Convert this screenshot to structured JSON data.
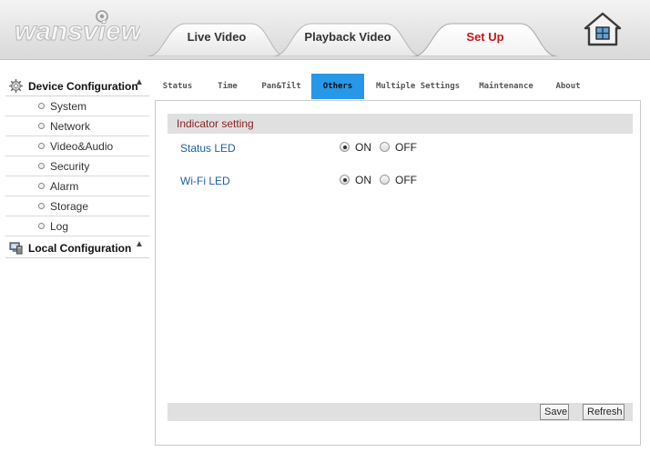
{
  "brand": {
    "logo_text": "wansview"
  },
  "nav": {
    "tabs": [
      {
        "label": "Live Video"
      },
      {
        "label": "Playback Video"
      },
      {
        "label": "Set Up",
        "active": true
      }
    ],
    "home_icon": "home-icon"
  },
  "sidebar": {
    "device_config": {
      "label": "Device Configuration",
      "icon": "gear-icon",
      "items": [
        {
          "label": "System"
        },
        {
          "label": "Network"
        },
        {
          "label": "Video&Audio"
        },
        {
          "label": "Security"
        },
        {
          "label": "Alarm"
        },
        {
          "label": "Storage"
        },
        {
          "label": "Log"
        }
      ]
    },
    "local_config": {
      "label": "Local Configuration",
      "icon": "computer-icon"
    }
  },
  "subtabs": [
    {
      "label": "Status"
    },
    {
      "label": "Time"
    },
    {
      "label": "Pan&Tilt"
    },
    {
      "label": "Others",
      "active": true
    },
    {
      "label": "Multiple Settings"
    },
    {
      "label": "Maintenance"
    },
    {
      "label": "About"
    }
  ],
  "panel": {
    "section_title": "Indicator setting",
    "settings": [
      {
        "label": "Status LED",
        "on_label": "ON",
        "off_label": "OFF",
        "value": "ON"
      },
      {
        "label": "Wi-Fi LED",
        "on_label": "ON",
        "off_label": "OFF",
        "value": "ON"
      }
    ],
    "buttons": {
      "save": "Save",
      "refresh": "Refresh"
    }
  },
  "colors": {
    "active_subtab": "#2897e6",
    "active_tab_text": "#c41818",
    "setting_label": "#1f5fa8",
    "section_title": "#8b2020"
  }
}
